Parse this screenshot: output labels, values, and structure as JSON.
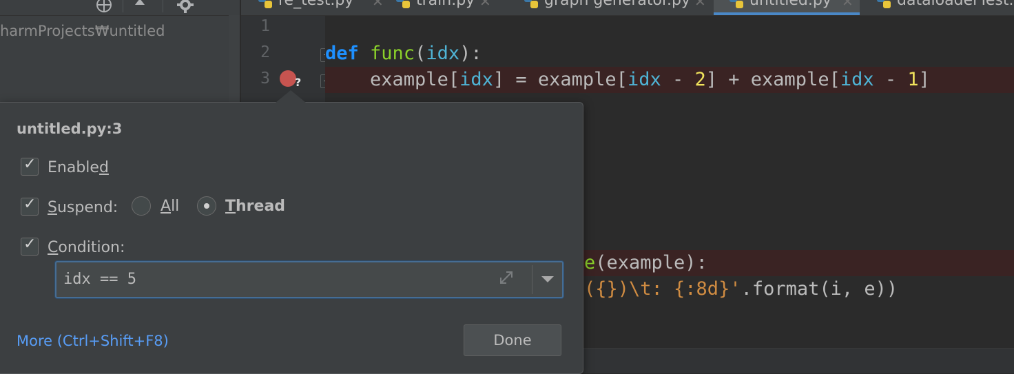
{
  "project_panel": {
    "path": "harmProjects₩untitled",
    "toolbar_icons": [
      "globe-icon",
      "collapse-up-icon",
      "gear-icon"
    ]
  },
  "tabs": [
    {
      "label": "re_test.py",
      "active": false
    },
    {
      "label": "train.py",
      "active": false
    },
    {
      "label": "graph generator.py",
      "active": false
    },
    {
      "label": "untitled.py",
      "active": true
    },
    {
      "label": "dataloaderTest.p",
      "active": false
    }
  ],
  "gutter": {
    "line_numbers": [
      "1",
      "2",
      "3"
    ]
  },
  "editor": {
    "line2": {
      "kw": "def",
      "fn": "func",
      "p1": "(",
      "param": "idx",
      "p2": "):"
    },
    "line3": {
      "a": "example[",
      "i1": "idx",
      "b": "] = example[",
      "i2": "idx",
      "c": " - ",
      "n1": "2",
      "d": "] + example[",
      "i3": "idx",
      "e": " - ",
      "n2": "1",
      "f": "]"
    },
    "line_partial_a": {
      "fn": "e",
      "rest": "(example):"
    },
    "line_partial_b": {
      "str": "({})\\t: {:8d}'",
      "rest": ".format(i, e))"
    }
  },
  "breakpoint_popup": {
    "title": "untitled.py:3",
    "enabled": {
      "label_pre": "Enable",
      "label_u": "d",
      "label_post": "",
      "checked": true
    },
    "suspend": {
      "label_pre": "",
      "label_u": "S",
      "label_post": "uspend:",
      "checked": true
    },
    "suspend_all": {
      "label_u": "A",
      "label_post": "ll",
      "selected": false
    },
    "suspend_thread": {
      "label_u": "T",
      "label_post": "hread",
      "selected": true
    },
    "condition": {
      "label_pre": "",
      "label_u": "C",
      "label_post": "ondition:",
      "checked": true
    },
    "condition_value": "idx == 5",
    "more_link": "More (Ctrl+Shift+F8)",
    "done_label": "Done"
  },
  "colors": {
    "background": "#2b2b2b",
    "panel": "#3c3f41",
    "keyword": "#1e90ff",
    "function": "#8bd12a",
    "number": "#f1e35c",
    "string": "#d08c42",
    "breakpoint": "#c75450",
    "link": "#589df6"
  }
}
